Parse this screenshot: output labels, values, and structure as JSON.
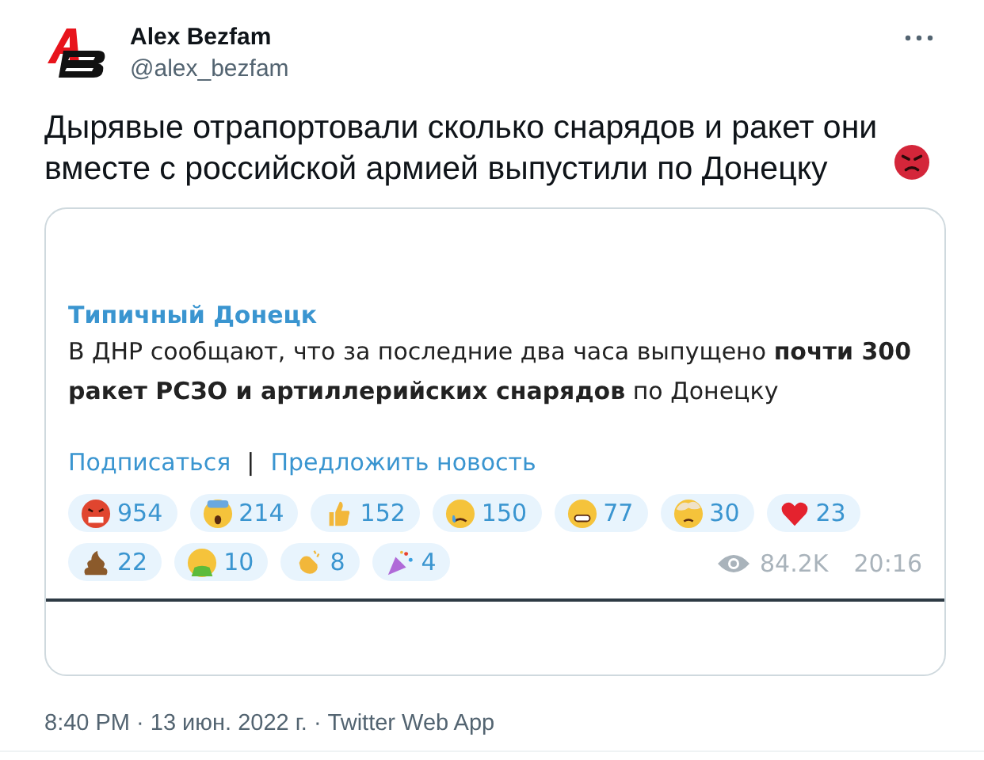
{
  "author": {
    "name": "Alex Bezfam",
    "handle": "@alex_bezfam"
  },
  "tweet_text": "Дырявые отрапортовали сколько снарядов и ракет они вместе с российской армией выпустили по Донецку",
  "embed": {
    "channel": "Типичный Донецк",
    "message": "В ДНР сообщают, что за последние два часа выпущено **почти 300 ракет РСЗО и артиллерийских снарядов** по Донецку",
    "links": [
      "Подписаться",
      "Предложить новость"
    ],
    "separator": "|",
    "reactions": [
      {
        "kind": "angry",
        "count": "954"
      },
      {
        "kind": "scream",
        "count": "214"
      },
      {
        "kind": "thumb",
        "count": "152"
      },
      {
        "kind": "cry",
        "count": "150"
      },
      {
        "kind": "grin",
        "count": "77"
      },
      {
        "kind": "exploding",
        "count": "30"
      },
      {
        "kind": "heart",
        "count": "23"
      },
      {
        "kind": "poo",
        "count": "22"
      },
      {
        "kind": "vomit",
        "count": "10"
      },
      {
        "kind": "clap",
        "count": "8"
      },
      {
        "kind": "party",
        "count": "4"
      }
    ],
    "views": "84.2K",
    "time": "20:16"
  },
  "footer": "8:40 PM · 13 июн. 2022 г. · Twitter Web App"
}
